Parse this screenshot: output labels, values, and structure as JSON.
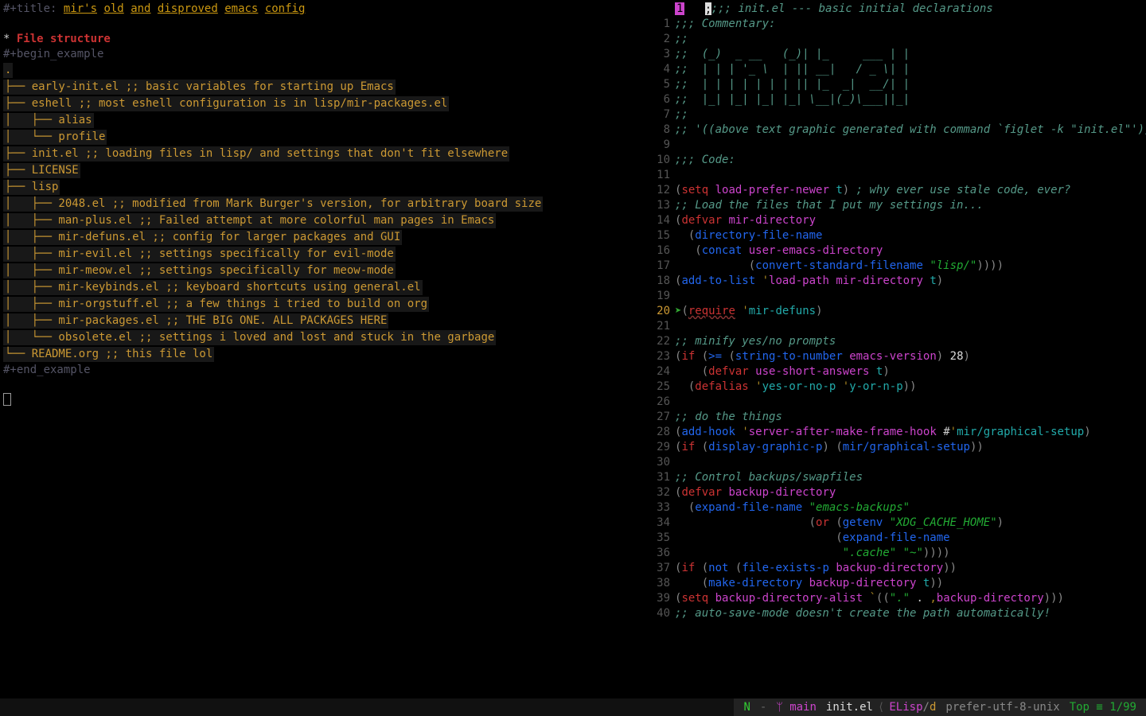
{
  "left": {
    "title_prefix": "#+title: ",
    "title_words": [
      "mir's",
      "old",
      "and",
      "disproved",
      "emacs",
      "config"
    ],
    "heading": "File structure",
    "begin": "#+begin_example",
    "end": "#+end_example",
    "tree": [
      ".",
      "├── early-init.el ;; basic variables for starting up Emacs",
      "├── eshell ;; most eshell configuration is in lisp/mir-packages.el",
      "│   ├── alias",
      "│   └── profile",
      "├── init.el ;; loading files in lisp/ and settings that don't fit elsewhere",
      "├── LICENSE",
      "├── lisp",
      "│   ├── 2048.el ;; modified from Mark Burger's version, for arbitrary board size",
      "│   ├── man-plus.el ;; Failed attempt at more colorful man pages in Emacs",
      "│   ├── mir-defuns.el ;; config for larger packages and GUI",
      "│   ├── mir-evil.el ;; settings specifically for evil-mode",
      "│   ├── mir-meow.el ;; settings specifically for meow-mode",
      "│   ├── mir-keybinds.el ;; keyboard shortcuts using general.el",
      "│   ├── mir-orgstuff.el ;; a few things i tried to build on org",
      "│   ├── mir-packages.el ;; THE BIG ONE. ALL PACKAGES HERE",
      "│   └── obsolete.el ;; settings i loved and lost and stuck in the garbage",
      "└── README.org ;; this file lol"
    ]
  },
  "right": {
    "bookmark": "1",
    "lines": [
      {
        "n": "",
        "t": [
          {
            "c": "c-com",
            "v": ";;; init.el --- basic initial declarations"
          }
        ]
      },
      {
        "n": "1",
        "t": [
          {
            "c": "c-com",
            "v": ";;; Commentary:"
          }
        ]
      },
      {
        "n": "2",
        "t": [
          {
            "c": "c-com",
            "v": ";;"
          }
        ]
      },
      {
        "n": "3",
        "t": [
          {
            "c": "c-com",
            "v": ";;  (_)  _ __   (_)| |_     ___ | |"
          }
        ]
      },
      {
        "n": "4",
        "t": [
          {
            "c": "c-com",
            "v": ";;  | | | '_ \\  | || __|   / _ \\| |"
          }
        ]
      },
      {
        "n": "5",
        "t": [
          {
            "c": "c-com",
            "v": ";;  | | | | | | | || |_  _|  __/| |"
          }
        ]
      },
      {
        "n": "6",
        "t": [
          {
            "c": "c-com",
            "v": ";;  |_| |_| |_| |_| \\__|(_)\\___||_|"
          }
        ]
      },
      {
        "n": "7",
        "t": [
          {
            "c": "c-com",
            "v": ";;"
          }
        ]
      },
      {
        "n": "8",
        "t": [
          {
            "c": "c-com",
            "v": ";; '((above text graphic generated with command `figlet -k \"init.el\"'))"
          }
        ],
        "wrap": true
      },
      {
        "n": "9",
        "t": []
      },
      {
        "n": "10",
        "t": [
          {
            "c": "c-com",
            "v": ";;; Code:"
          }
        ]
      },
      {
        "n": "11",
        "t": []
      },
      {
        "n": "12",
        "t": [
          {
            "c": "c-paren",
            "v": "("
          },
          {
            "c": "c-kw",
            "v": "setq"
          },
          {
            "c": "",
            "v": " "
          },
          {
            "c": "c-var",
            "v": "load-prefer-newer"
          },
          {
            "c": "",
            "v": " "
          },
          {
            "c": "c-sym",
            "v": "t"
          },
          {
            "c": "c-paren",
            "v": ")"
          },
          {
            "c": "",
            "v": " "
          },
          {
            "c": "c-com",
            "v": "; why ever use stale code, ever?"
          }
        ]
      },
      {
        "n": "13",
        "t": [
          {
            "c": "c-com",
            "v": ";; Load the files that I put my settings in..."
          }
        ]
      },
      {
        "n": "14",
        "t": [
          {
            "c": "c-paren",
            "v": "("
          },
          {
            "c": "c-kw",
            "v": "defvar"
          },
          {
            "c": "",
            "v": " "
          },
          {
            "c": "c-var",
            "v": "mir-directory"
          }
        ]
      },
      {
        "n": "15",
        "t": [
          {
            "c": "",
            "v": "  "
          },
          {
            "c": "c-paren",
            "v": "("
          },
          {
            "c": "c-fn",
            "v": "directory-file-name"
          }
        ]
      },
      {
        "n": "16",
        "t": [
          {
            "c": "",
            "v": "   "
          },
          {
            "c": "c-paren",
            "v": "("
          },
          {
            "c": "c-fn",
            "v": "concat"
          },
          {
            "c": "",
            "v": " "
          },
          {
            "c": "c-var",
            "v": "user-emacs-directory"
          }
        ]
      },
      {
        "n": "17",
        "t": [
          {
            "c": "",
            "v": "           "
          },
          {
            "c": "c-paren",
            "v": "("
          },
          {
            "c": "c-fn",
            "v": "convert-standard-filename"
          },
          {
            "c": "",
            "v": " "
          },
          {
            "c": "c-str",
            "v": "\"lisp/\""
          },
          {
            "c": "c-paren",
            "v": "))))"
          }
        ]
      },
      {
        "n": "18",
        "t": [
          {
            "c": "c-paren",
            "v": "("
          },
          {
            "c": "c-fn",
            "v": "add-to-list"
          },
          {
            "c": "",
            "v": " "
          },
          {
            "c": "c-op",
            "v": "'"
          },
          {
            "c": "c-var",
            "v": "load-path"
          },
          {
            "c": "",
            "v": " "
          },
          {
            "c": "c-var",
            "v": "mir-directory"
          },
          {
            "c": "",
            "v": " "
          },
          {
            "c": "c-sym",
            "v": "t"
          },
          {
            "c": "c-paren",
            "v": ")"
          }
        ]
      },
      {
        "n": "19",
        "t": []
      },
      {
        "n": "20",
        "hl": true,
        "arrow": true,
        "t": [
          {
            "c": "c-paren",
            "v": "("
          },
          {
            "c": "c-kw c-ul",
            "v": "require"
          },
          {
            "c": "",
            "v": " "
          },
          {
            "c": "c-op",
            "v": "'"
          },
          {
            "c": "c-sym",
            "v": "mir-defuns"
          },
          {
            "c": "c-paren",
            "v": ")"
          }
        ]
      },
      {
        "n": "21",
        "t": []
      },
      {
        "n": "22",
        "t": [
          {
            "c": "c-com",
            "v": ";; minify yes/no prompts"
          }
        ]
      },
      {
        "n": "23",
        "t": [
          {
            "c": "c-paren",
            "v": "("
          },
          {
            "c": "c-kw",
            "v": "if"
          },
          {
            "c": "",
            "v": " "
          },
          {
            "c": "c-paren",
            "v": "("
          },
          {
            "c": "c-fn",
            "v": ">="
          },
          {
            "c": "",
            "v": " "
          },
          {
            "c": "c-paren",
            "v": "("
          },
          {
            "c": "c-fn",
            "v": "string-to-number"
          },
          {
            "c": "",
            "v": " "
          },
          {
            "c": "c-var",
            "v": "emacs-version"
          },
          {
            "c": "c-paren",
            "v": ")"
          },
          {
            "c": "",
            "v": " "
          },
          {
            "c": "c-num",
            "v": "28"
          },
          {
            "c": "c-paren",
            "v": ")"
          }
        ]
      },
      {
        "n": "24",
        "t": [
          {
            "c": "",
            "v": "    "
          },
          {
            "c": "c-paren",
            "v": "("
          },
          {
            "c": "c-kw",
            "v": "defvar"
          },
          {
            "c": "",
            "v": " "
          },
          {
            "c": "c-var",
            "v": "use-short-answers"
          },
          {
            "c": "",
            "v": " "
          },
          {
            "c": "c-sym",
            "v": "t"
          },
          {
            "c": "c-paren",
            "v": ")"
          }
        ]
      },
      {
        "n": "25",
        "t": [
          {
            "c": "",
            "v": "  "
          },
          {
            "c": "c-paren",
            "v": "("
          },
          {
            "c": "c-kw",
            "v": "defalias"
          },
          {
            "c": "",
            "v": " "
          },
          {
            "c": "c-op",
            "v": "'"
          },
          {
            "c": "c-sym",
            "v": "yes-or-no-p"
          },
          {
            "c": "",
            "v": " "
          },
          {
            "c": "c-op",
            "v": "'"
          },
          {
            "c": "c-sym",
            "v": "y-or-n-p"
          },
          {
            "c": "c-paren",
            "v": "))"
          }
        ]
      },
      {
        "n": "26",
        "t": []
      },
      {
        "n": "27",
        "t": [
          {
            "c": "c-com",
            "v": ";; do the things"
          }
        ]
      },
      {
        "n": "28",
        "t": [
          {
            "c": "c-paren",
            "v": "("
          },
          {
            "c": "c-fn",
            "v": "add-hook"
          },
          {
            "c": "",
            "v": " "
          },
          {
            "c": "c-op",
            "v": "'"
          },
          {
            "c": "c-var",
            "v": "server-after-make-frame-hook"
          },
          {
            "c": "",
            "v": " #"
          },
          {
            "c": "c-op",
            "v": "'"
          },
          {
            "c": "c-sym",
            "v": "mir/graphical-setup"
          },
          {
            "c": "c-paren",
            "v": ")"
          }
        ],
        "wrap": true
      },
      {
        "n": "29",
        "t": [
          {
            "c": "c-paren",
            "v": "("
          },
          {
            "c": "c-kw",
            "v": "if"
          },
          {
            "c": "",
            "v": " "
          },
          {
            "c": "c-paren",
            "v": "("
          },
          {
            "c": "c-fn",
            "v": "display-graphic-p"
          },
          {
            "c": "c-paren",
            "v": ")"
          },
          {
            "c": "",
            "v": " "
          },
          {
            "c": "c-paren",
            "v": "("
          },
          {
            "c": "c-fn",
            "v": "mir/graphical-setup"
          },
          {
            "c": "c-paren",
            "v": "))"
          }
        ]
      },
      {
        "n": "30",
        "t": []
      },
      {
        "n": "31",
        "t": [
          {
            "c": "c-com",
            "v": ";; Control backups/swapfiles"
          }
        ]
      },
      {
        "n": "32",
        "t": [
          {
            "c": "c-paren",
            "v": "("
          },
          {
            "c": "c-kw",
            "v": "defvar"
          },
          {
            "c": "",
            "v": " "
          },
          {
            "c": "c-var",
            "v": "backup-directory"
          }
        ]
      },
      {
        "n": "33",
        "t": [
          {
            "c": "",
            "v": "  "
          },
          {
            "c": "c-paren",
            "v": "("
          },
          {
            "c": "c-fn",
            "v": "expand-file-name"
          },
          {
            "c": "",
            "v": " "
          },
          {
            "c": "c-str",
            "v": "\"emacs-backups\""
          }
        ]
      },
      {
        "n": "34",
        "t": [
          {
            "c": "",
            "v": "                    "
          },
          {
            "c": "c-paren",
            "v": "("
          },
          {
            "c": "c-kw",
            "v": "or"
          },
          {
            "c": "",
            "v": " "
          },
          {
            "c": "c-paren",
            "v": "("
          },
          {
            "c": "c-fn",
            "v": "getenv"
          },
          {
            "c": "",
            "v": " "
          },
          {
            "c": "c-str",
            "v": "\"XDG_CACHE_HOME\""
          },
          {
            "c": "c-paren",
            "v": ")"
          }
        ]
      },
      {
        "n": "35",
        "t": [
          {
            "c": "",
            "v": "                        "
          },
          {
            "c": "c-paren",
            "v": "("
          },
          {
            "c": "c-fn",
            "v": "expand-file-name"
          }
        ]
      },
      {
        "n": "36",
        "t": [
          {
            "c": "",
            "v": "                         "
          },
          {
            "c": "c-str",
            "v": "\".cache\""
          },
          {
            "c": "",
            "v": " "
          },
          {
            "c": "c-str",
            "v": "\"~\""
          },
          {
            "c": "c-paren",
            "v": "))))"
          }
        ]
      },
      {
        "n": "37",
        "t": [
          {
            "c": "c-paren",
            "v": "("
          },
          {
            "c": "c-kw",
            "v": "if"
          },
          {
            "c": "",
            "v": " "
          },
          {
            "c": "c-paren",
            "v": "("
          },
          {
            "c": "c-fn",
            "v": "not"
          },
          {
            "c": "",
            "v": " "
          },
          {
            "c": "c-paren",
            "v": "("
          },
          {
            "c": "c-fn",
            "v": "file-exists-p"
          },
          {
            "c": "",
            "v": " "
          },
          {
            "c": "c-var",
            "v": "backup-directory"
          },
          {
            "c": "c-paren",
            "v": "))"
          }
        ]
      },
      {
        "n": "38",
        "t": [
          {
            "c": "",
            "v": "    "
          },
          {
            "c": "c-paren",
            "v": "("
          },
          {
            "c": "c-fn",
            "v": "make-directory"
          },
          {
            "c": "",
            "v": " "
          },
          {
            "c": "c-var",
            "v": "backup-directory"
          },
          {
            "c": "",
            "v": " "
          },
          {
            "c": "c-sym",
            "v": "t"
          },
          {
            "c": "c-paren",
            "v": "))"
          }
        ]
      },
      {
        "n": "39",
        "t": [
          {
            "c": "c-paren",
            "v": "("
          },
          {
            "c": "c-kw",
            "v": "setq"
          },
          {
            "c": "",
            "v": " "
          },
          {
            "c": "c-var",
            "v": "backup-directory-alist"
          },
          {
            "c": "",
            "v": " "
          },
          {
            "c": "c-op",
            "v": "`"
          },
          {
            "c": "c-paren",
            "v": "(("
          },
          {
            "c": "c-str",
            "v": "\".\""
          },
          {
            "c": "",
            "v": " . "
          },
          {
            "c": "c-op",
            "v": ","
          },
          {
            "c": "c-var",
            "v": "backup-directory"
          },
          {
            "c": "c-paren",
            "v": ")))"
          }
        ]
      },
      {
        "n": "40",
        "t": [
          {
            "c": "c-com",
            "v": ";; auto-save-mode doesn't create the path automatically!"
          }
        ]
      }
    ]
  },
  "modeline": {
    "n": "N",
    "sep1": "-",
    "branch": "main",
    "file": "init.el",
    "mode": "ELisp",
    "d": "d",
    "enc": "prefer-utf-8-unix",
    "pos": "Top ≡ 1/99"
  }
}
